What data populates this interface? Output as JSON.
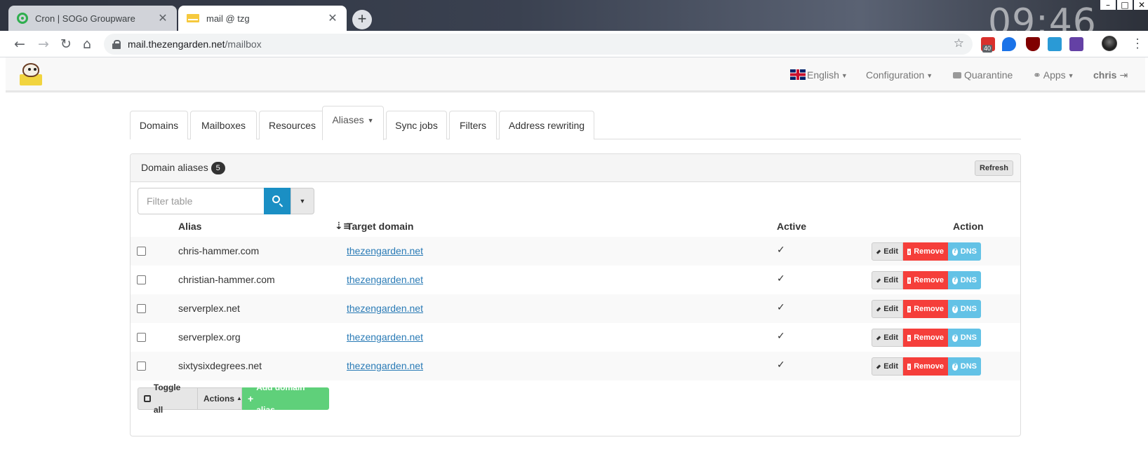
{
  "browser": {
    "clock": "09:46",
    "tabs": [
      {
        "title": "Cron | SOGo Groupware",
        "close": "✕"
      },
      {
        "title": "mail @ tzg",
        "close": "✕"
      }
    ],
    "new_tab": "+",
    "nav": {
      "back": "←",
      "forward": "→",
      "reload": "↻",
      "home": "⌂"
    },
    "url_host": "mail.thezengarden.net",
    "url_path": "/mailbox",
    "star": "☆",
    "ext_badge": "40",
    "menu": "⋮",
    "window": {
      "minimize": "–",
      "maximize": "□",
      "close": "✕"
    }
  },
  "appnav": {
    "language": "English",
    "configuration": "Configuration",
    "quarantine": "Quarantine",
    "apps": "Apps",
    "user": "chris"
  },
  "tabs": [
    {
      "label": "Domains"
    },
    {
      "label": "Mailboxes"
    },
    {
      "label": "Resources"
    },
    {
      "label": "Aliases"
    },
    {
      "label": "Sync jobs"
    },
    {
      "label": "Filters"
    },
    {
      "label": "Address rewriting"
    }
  ],
  "panel": {
    "title": "Domain aliases",
    "count": "5",
    "refresh": "Refresh",
    "filter_placeholder": "Filter table"
  },
  "table": {
    "columns": {
      "alias": "Alias",
      "target": "Target domain",
      "active": "Active",
      "action": "Action"
    },
    "rows": [
      {
        "alias": "chris-hammer.com",
        "target": "thezengarden.net",
        "active": "✓"
      },
      {
        "alias": "christian-hammer.com",
        "target": "thezengarden.net",
        "active": "✓"
      },
      {
        "alias": "serverplex.net",
        "target": "thezengarden.net",
        "active": "✓"
      },
      {
        "alias": "serverplex.org",
        "target": "thezengarden.net",
        "active": "✓"
      },
      {
        "alias": "sixtysixdegrees.net",
        "target": "thezengarden.net",
        "active": "✓"
      }
    ],
    "row_actions": {
      "edit": "Edit",
      "remove": "Remove",
      "dns": "DNS"
    }
  },
  "footer": {
    "toggle_all": "Toggle all",
    "actions": "Actions",
    "add": "Add domain alias"
  },
  "colors": {
    "search": "#1a8fc4",
    "remove": "#f53e3a",
    "dns": "#63c2e6",
    "add": "#5fd07a",
    "link": "#2a7bb6"
  }
}
